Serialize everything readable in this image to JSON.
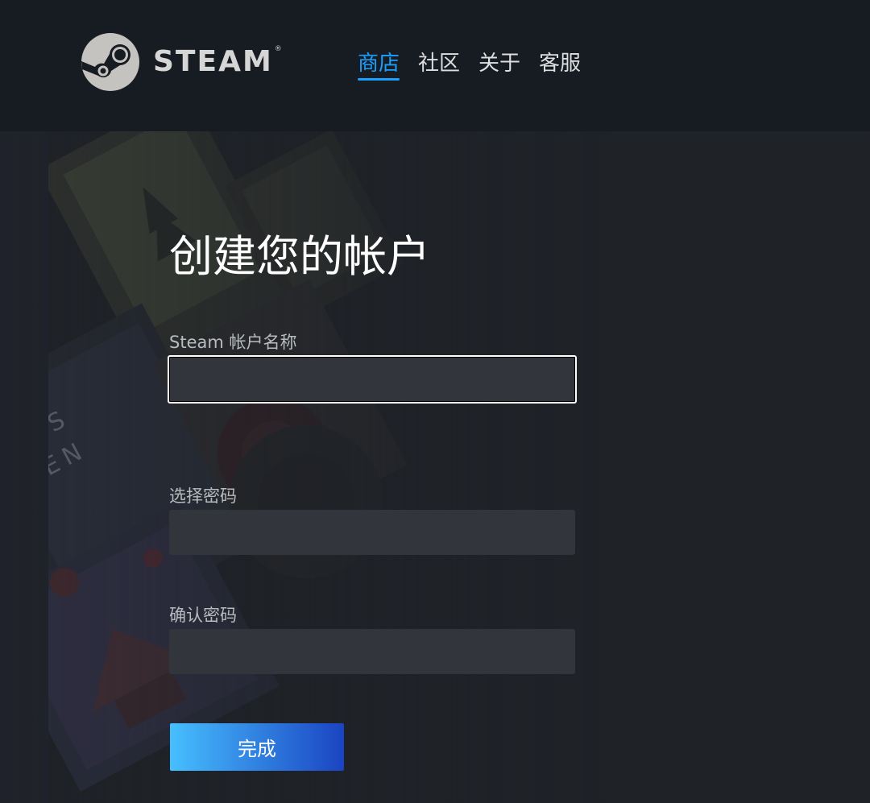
{
  "header": {
    "logo_text": "STEAM",
    "logo_reg": "®",
    "nav": [
      {
        "label": "商店",
        "active": true
      },
      {
        "label": "社区",
        "active": false
      },
      {
        "label": "关于",
        "active": false
      },
      {
        "label": "客服",
        "active": false
      }
    ]
  },
  "form": {
    "title": "创建您的帐户",
    "account_name_label": "Steam 帐户名称",
    "account_name_value": "",
    "password_label": "选择密码",
    "password_value": "",
    "confirm_label": "确认密码",
    "confirm_value": "",
    "submit_label": "完成"
  },
  "colors": {
    "header_bg": "#171b22",
    "page_bg": "#1f2227",
    "accent": "#1a9fff",
    "input_bg": "#32353c",
    "button_gradient_start": "#47bfff",
    "button_gradient_end": "#1a44c2"
  },
  "icons": {
    "logo": "steam-logo-icon"
  }
}
